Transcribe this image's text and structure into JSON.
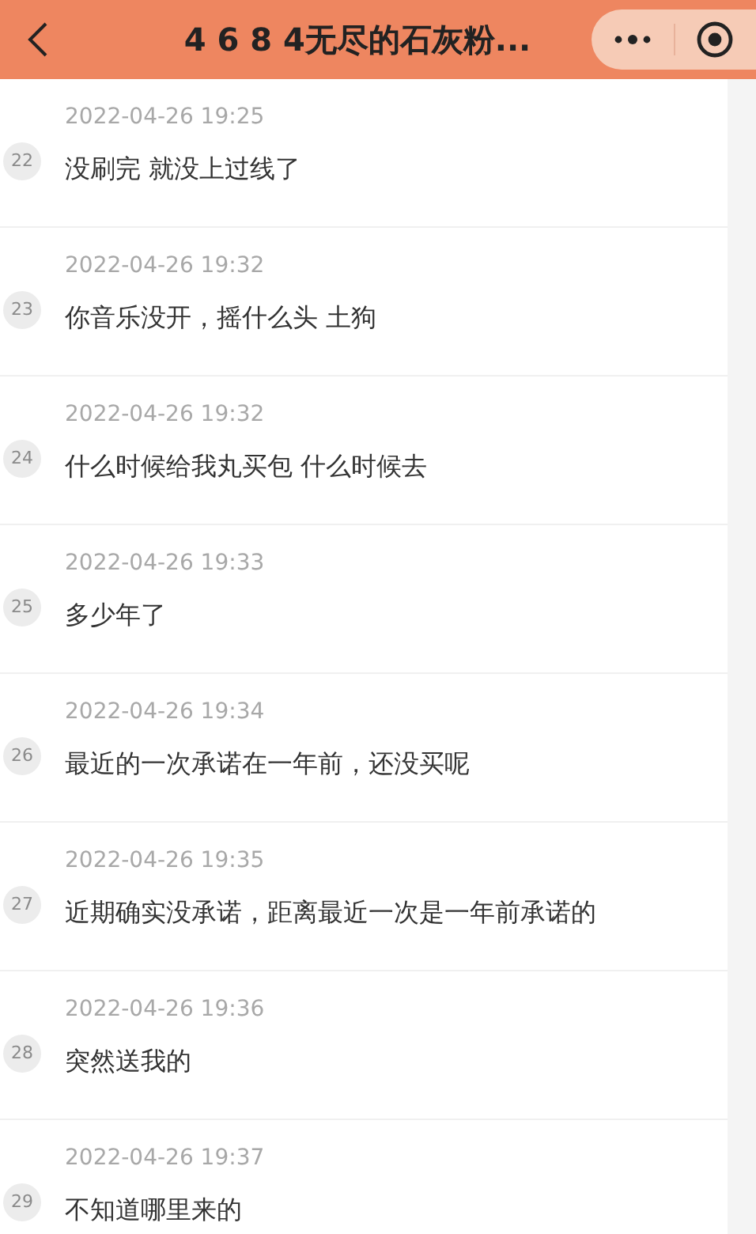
{
  "header": {
    "title": "4 6 8 4无尽的石灰粉..."
  },
  "messages": [
    {
      "number": "22",
      "time": "2022-04-26 19:25",
      "text": "没刷完 就没上过线了"
    },
    {
      "number": "23",
      "time": "2022-04-26 19:32",
      "text": "你音乐没开，摇什么头 土狗"
    },
    {
      "number": "24",
      "time": "2022-04-26 19:32",
      "text": "什么时候给我丸买包 什么时候去"
    },
    {
      "number": "25",
      "time": "2022-04-26 19:33",
      "text": "多少年了"
    },
    {
      "number": "26",
      "time": "2022-04-26 19:34",
      "text": "最近的一次承诺在一年前，还没买呢"
    },
    {
      "number": "27",
      "time": "2022-04-26 19:35",
      "text": "近期确实没承诺，距离最近一次是一年前承诺的"
    },
    {
      "number": "28",
      "time": "2022-04-26 19:36",
      "text": "突然送我的"
    },
    {
      "number": "29",
      "time": "2022-04-26 19:37",
      "text": "不知道哪里来的"
    }
  ]
}
